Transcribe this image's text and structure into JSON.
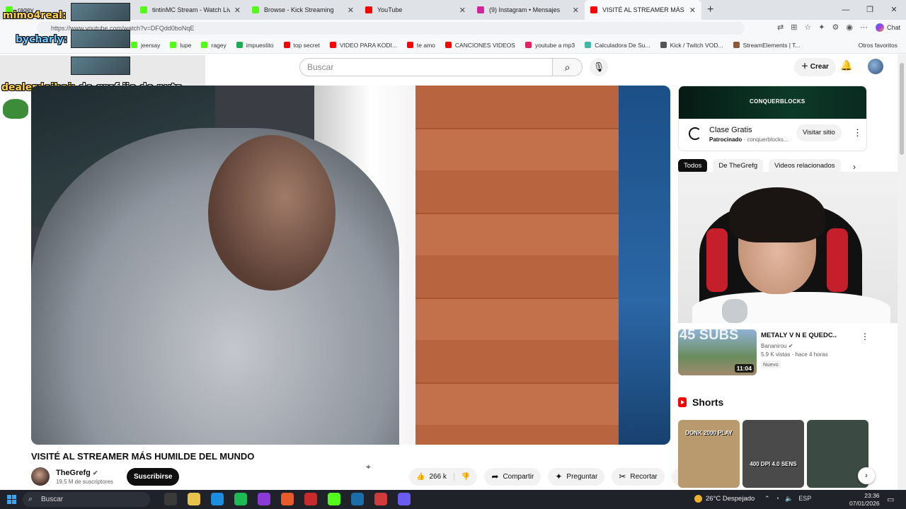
{
  "browser": {
    "tabs": [
      {
        "title": "ragey",
        "color": "#53fc18",
        "active": false
      },
      {
        "title": "tintinMC Stream - Watch Live",
        "color": "#53fc18",
        "active": false
      },
      {
        "title": "Browse - Kick Streaming",
        "color": "#53fc18",
        "active": false
      },
      {
        "title": "YouTube",
        "color": "#ff0000",
        "active": false
      },
      {
        "title": "(9) Instagram • Mensajes",
        "color": "#d6249f",
        "active": false
      },
      {
        "title": "VISITÉ AL STREAMER MÁS HU",
        "color": "#ff0000",
        "active": true
      }
    ],
    "url": "https://www.youtube.com/watch?v=DFQdd0boNqE",
    "chat_label": "Chat",
    "bookmarks": [
      {
        "label": "jeersay",
        "color": "#53fc18"
      },
      {
        "label": "lupe",
        "color": "#53fc18"
      },
      {
        "label": "ragey",
        "color": "#53fc18"
      },
      {
        "label": "impuestito",
        "color": "#1faa59"
      },
      {
        "label": "top secret",
        "color": "#ff0000"
      },
      {
        "label": "VIDEO PARA KODI...",
        "color": "#ff0000"
      },
      {
        "label": "te amo",
        "color": "#ff0000"
      },
      {
        "label": "CANCIONES VIDEOS",
        "color": "#ff0000"
      },
      {
        "label": "youtube a mp3",
        "color": "#e0245e"
      },
      {
        "label": "Calculadora De Su...",
        "color": "#3fb9a6"
      },
      {
        "label": "Kick / Twitch VOD...",
        "color": "#555555"
      },
      {
        "label": "StreamElements | T...",
        "color": "#8b5a3c"
      }
    ],
    "other_bookmarks": "Otros favoritos"
  },
  "overlay": {
    "user1": "mimo4real:",
    "user2": "bycharly:",
    "chat_user": "dealerdeibai:",
    "chat_text": " de gref ijo de puta"
  },
  "youtube": {
    "search_placeholder": "Buscar",
    "create_label": "Crear"
  },
  "video": {
    "title": "VISITÉ AL STREAMER MÁS HUMILDE DEL MUNDO",
    "channel": "TheGrefg",
    "subscribers": "19.5 M de suscriptores",
    "subscribe_label": "Suscribirse",
    "likes": "266 k",
    "share_label": "Compartir",
    "ask_label": "Preguntar",
    "clip_label": "Recortar"
  },
  "ad": {
    "brand": "CONQUERBLOCKS",
    "title": "Clase Gratis",
    "sponsored": "Patrocinado",
    "domain": "· conquerblocks...",
    "visit_label": "Visitar sitio"
  },
  "chips": [
    "Todos",
    "De TheGrefg",
    "Videos relacionados"
  ],
  "recommendation": {
    "thumb_text": "45 SUBS",
    "duration": "11:04",
    "title": "METALY V N E QUEDC..",
    "channel": "Bananirou",
    "meta": "5.9 K vistas · hace 4 horas",
    "badge": "Nuevo"
  },
  "shorts": {
    "heading": "Shorts",
    "items": [
      {
        "caption": "DONK 2000 PLAY",
        "color": "#b89a6e"
      },
      {
        "caption": "400 DPI 4.0 SENS",
        "color": "#4a4a4a"
      },
      {
        "caption": "",
        "color": "#3c4a44"
      }
    ]
  },
  "taskbar": {
    "search_label": "Buscar",
    "weather": "26°C  Despejado",
    "language": "ESP",
    "time": "23:36",
    "date": "07/01/2026",
    "apps": [
      "#3a3a3a",
      "#e8c24a",
      "#1c8ddf",
      "#1db954",
      "#8a3ad6",
      "#e85a2a",
      "#c72b2b",
      "#53fc18",
      "#1b6ea8",
      "#d23b3b",
      "#6a5cf0"
    ]
  }
}
